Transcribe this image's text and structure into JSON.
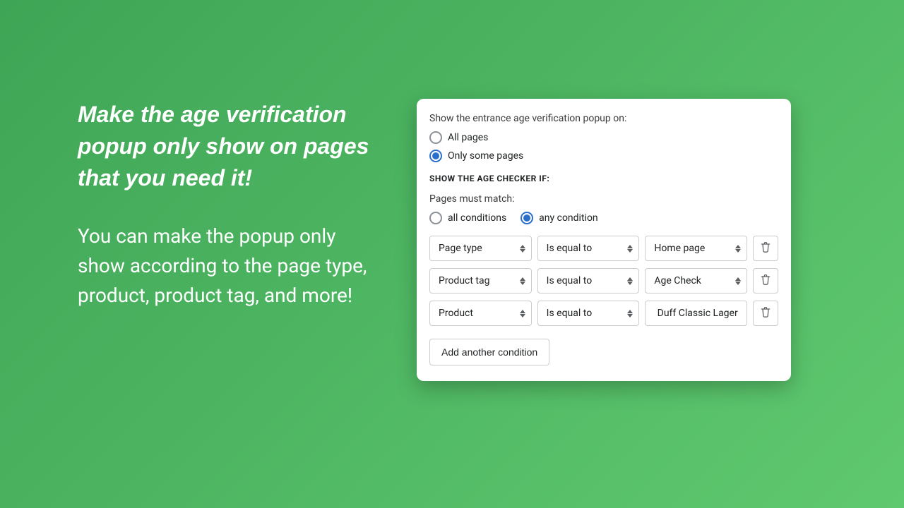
{
  "promo": {
    "heading": "Make the age verification popup only show on pages that you need it!",
    "sub": "You can make the popup only show according to the page type, product, product tag, and more!"
  },
  "card": {
    "show_on_label": "Show the entrance age verification popup on:",
    "show_on": {
      "all_label": "All pages",
      "some_label": "Only some pages",
      "selected": "some"
    },
    "section_heading": "Show the age checker if:",
    "match_label": "Pages must match:",
    "match": {
      "all_label": "all conditions",
      "any_label": "any condition",
      "selected": "any"
    },
    "conditions": [
      {
        "field": "Page type",
        "op": "Is equal to",
        "value": "Home page",
        "value_is_select": true
      },
      {
        "field": "Product tag",
        "op": "Is equal to",
        "value": "Age Check",
        "value_is_select": true
      },
      {
        "field": "Product",
        "op": "Is equal to",
        "value": "Duff Classic Lager",
        "value_is_select": false
      }
    ],
    "add_label": "Add another condition"
  }
}
